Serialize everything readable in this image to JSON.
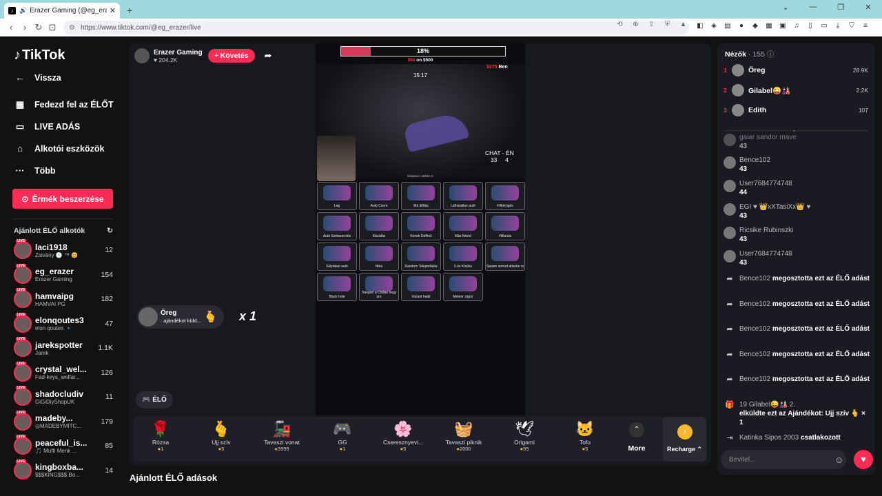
{
  "browser": {
    "tab_title": "Erazer Gaming (@eg_erazer) | ",
    "url": "https://www.tiktok.com/@eg_erazer/live"
  },
  "sidebar": {
    "logo": "TikTok",
    "nav": [
      {
        "label": "Vissza",
        "icon": "arrow-left-icon"
      },
      {
        "label": "Fedezd fel az ÉLŐT",
        "icon": "calendar-icon"
      },
      {
        "label": "LIVE ADÁS",
        "icon": "video-icon"
      },
      {
        "label": "Alkotói eszközök",
        "icon": "creator-tools-icon"
      },
      {
        "label": "Több",
        "icon": "more-icon"
      }
    ],
    "coins_button": "Érmék beszerzése",
    "recommended_title": "Ajánlott ÉLŐ alkotók",
    "creators": [
      {
        "name": "laci1918",
        "sub": "Zsivány 🕒 ™ 😊",
        "count": "12"
      },
      {
        "name": "eg_erazer",
        "sub": "Erazer Gaming",
        "count": "154"
      },
      {
        "name": "hamvaipg",
        "sub": "HAMVAI PG",
        "count": "182"
      },
      {
        "name": "elonqoutes3",
        "sub": "elon qoutes 🔹",
        "count": "47"
      },
      {
        "name": "jarekspotter",
        "sub": "Jarek",
        "count": "1.1K"
      },
      {
        "name": "crystal_wel...",
        "sub": "Fad-keys_welfar...",
        "count": "126"
      },
      {
        "name": "shadocludiv",
        "sub": "GiGiDiyShopUK",
        "count": "11"
      },
      {
        "name": "madeby...",
        "sub": "◎MADEBYMITC...",
        "count": "179"
      },
      {
        "name": "peaceful_is...",
        "sub": "🎵 Mufti Menk ...",
        "count": "85"
      },
      {
        "name": "kingboxba...",
        "sub": "$$$KING$$$ Bo...",
        "count": "14"
      }
    ]
  },
  "stream": {
    "host_name": "Erazer Gaming",
    "host_likes": "♥ 204.2K",
    "follow": "+ Követés",
    "progress_label": "18%",
    "progress": 0.18,
    "goal_a": "$92",
    "goal_b": " on $500",
    "ben_amt": "$375",
    "ben": " Ben",
    "clock": "15:17",
    "chat_label": "CHAT - ÉN",
    "chat_a": "33",
    "chat_b": "4",
    "distance": "Distance: 18432 m",
    "grid": [
      "Lag",
      "Autó Csere",
      "Mű állítás",
      "Láthatatlan autó",
      "Főkérügés",
      "Autó Szétszerelés",
      "Kiszálás",
      "Kenek Deffect",
      "Más Nézet",
      "Villlanás",
      "Súlytalan autó",
      "Nitro",
      "Random Teleportálás",
      "5 ös Közlés",
      "Spawn armed attacke rs",
      "Black hole",
      "Teleport a Chillas hegy ure",
      "Instant halál",
      "Meteor zápor"
    ],
    "gift_user": "Öreg",
    "gift_msg": ": ajándékot küld...",
    "multiplier": "x 1",
    "elo": "ÉLŐ"
  },
  "gifts": [
    {
      "name": "Rózsa",
      "price": "1",
      "icon": "🌹"
    },
    {
      "name": "Ujj szív",
      "price": "5",
      "icon": "🫰"
    },
    {
      "name": "Tavaszi vonat",
      "price": "3999",
      "icon": "🚂"
    },
    {
      "name": "GG",
      "price": "1",
      "icon": "🎮"
    },
    {
      "name": "Cseresznyevi...",
      "price": "5",
      "icon": "🌸"
    },
    {
      "name": "Tavaszi piknik",
      "price": "2000",
      "icon": "🧺"
    },
    {
      "name": "Origami",
      "price": "99",
      "icon": "🕊"
    },
    {
      "name": "Tofu",
      "price": "5",
      "icon": "🐱"
    }
  ],
  "more_label": "More",
  "recharge_label": "Recharge ⌃",
  "recommended_streams": "Ajánlott ÉLŐ adások",
  "viewers": {
    "title": "Nézők",
    "count": "· 155",
    "top": [
      {
        "rank": "1",
        "name": "Öreg",
        "score": "28.9K"
      },
      {
        "rank": "2",
        "name": "Gilabel😜🎎",
        "score": "2.2K"
      },
      {
        "rank": "3",
        "name": "Edith",
        "score": "107"
      }
    ]
  },
  "chat": [
    {
      "user": "Bence102",
      "msg": "43"
    },
    {
      "user": "User7684774748",
      "msg": "44"
    },
    {
      "user": "EGI ♥ 👑xXTasiXx👑 ♥",
      "msg": "43"
    },
    {
      "user": "Ricsike Rubinszki",
      "msg": "43"
    },
    {
      "user": "User7684774748",
      "msg": "43"
    }
  ],
  "shares": [
    {
      "user": "Bence102",
      "msg": "megosztotta ezt az ÉLŐ adást"
    },
    {
      "user": "Bence102",
      "msg": "megosztotta ezt az ÉLŐ adást"
    },
    {
      "user": "Bence102",
      "msg": "megosztotta ezt az ÉLŐ adást"
    },
    {
      "user": "Bence102",
      "msg": "megosztotta ezt az ÉLŐ adást"
    },
    {
      "user": "Bence102",
      "msg": "megosztotta ezt az ÉLŐ adást"
    }
  ],
  "gift_chat": {
    "user": "19 Gilabel😜🎎 2.",
    "msg": "elküldte ezt az Ajándékot: Ujj szív 🫰 × 1"
  },
  "join": {
    "user": "Katinka Sipos 2003",
    "msg": "csatlakozott"
  },
  "input_placeholder": "Bevitel...",
  "partial_top": "gaiar sandor mave",
  "partial_top_val": "43"
}
